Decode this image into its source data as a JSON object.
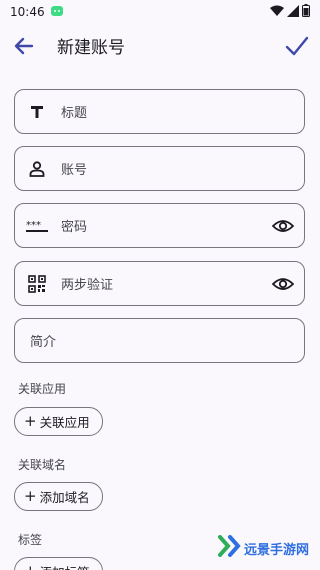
{
  "status_bar": {
    "time": "10:46"
  },
  "app_bar": {
    "title": "新建账号"
  },
  "fields": {
    "title": {
      "label": "标题",
      "icon": "title-icon"
    },
    "account": {
      "label": "账号",
      "icon": "person-icon"
    },
    "password": {
      "label": "密码",
      "icon": "password-dots-icon"
    },
    "two_factor": {
      "label": "两步验证",
      "icon": "qr-code-icon"
    },
    "intro": {
      "label": "简介"
    }
  },
  "sections": {
    "linked_app": {
      "label": "关联应用",
      "button": "关联应用"
    },
    "linked_domain": {
      "label": "关联域名",
      "button": "添加域名"
    },
    "tags": {
      "label": "标签",
      "button": "添加标签"
    }
  },
  "watermark": {
    "text": "远景手游网"
  },
  "colors": {
    "accent": "#3f4aa8",
    "outline": "#77767f",
    "background": "#fbf8fd"
  }
}
